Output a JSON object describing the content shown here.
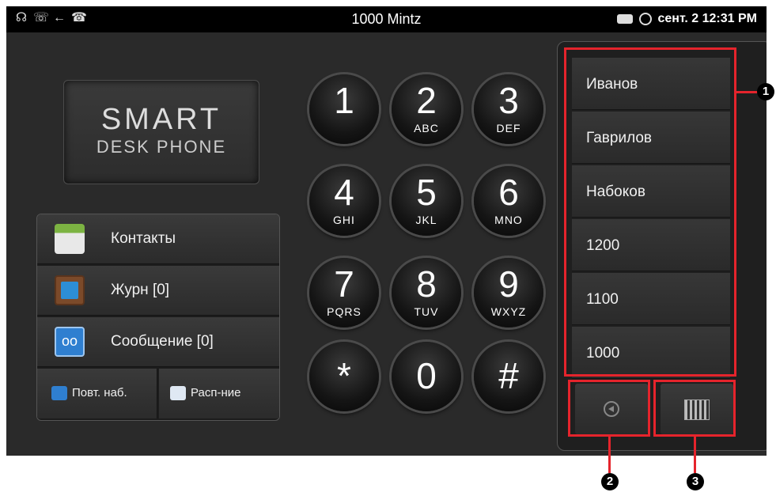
{
  "statusbar": {
    "title": "1000  Mintz",
    "datetime": "сент. 2 12:31 PM",
    "left_icons": [
      "headset-icon",
      "call-forward-icon",
      "handset-icon"
    ],
    "right_icons": [
      "handset-icon",
      "alarm-icon"
    ]
  },
  "logo": {
    "line1": "SMART",
    "line2": "DESK PHONE"
  },
  "menu": {
    "contacts": "Контакты",
    "log": "Журн [0]",
    "messages": "Сообщение [0]",
    "redial": "Повт. наб.",
    "schedule": "Расп-ние"
  },
  "keypad": [
    {
      "digit": "1",
      "letters": ""
    },
    {
      "digit": "2",
      "letters": "ABC"
    },
    {
      "digit": "3",
      "letters": "DEF"
    },
    {
      "digit": "4",
      "letters": "GHI"
    },
    {
      "digit": "5",
      "letters": "JKL"
    },
    {
      "digit": "6",
      "letters": "MNO"
    },
    {
      "digit": "7",
      "letters": "PQRS"
    },
    {
      "digit": "8",
      "letters": "TUV"
    },
    {
      "digit": "9",
      "letters": "WXYZ"
    },
    {
      "digit": "*",
      "letters": ""
    },
    {
      "digit": "0",
      "letters": ""
    },
    {
      "digit": "#",
      "letters": ""
    }
  ],
  "recent": [
    "Иванов",
    "Гаврилов",
    "Набоков",
    "1200",
    "1100",
    "1000"
  ],
  "callouts": [
    "1",
    "2",
    "3"
  ],
  "colors": {
    "callout_red": "#e5242c",
    "background": "#2a2a2a"
  }
}
